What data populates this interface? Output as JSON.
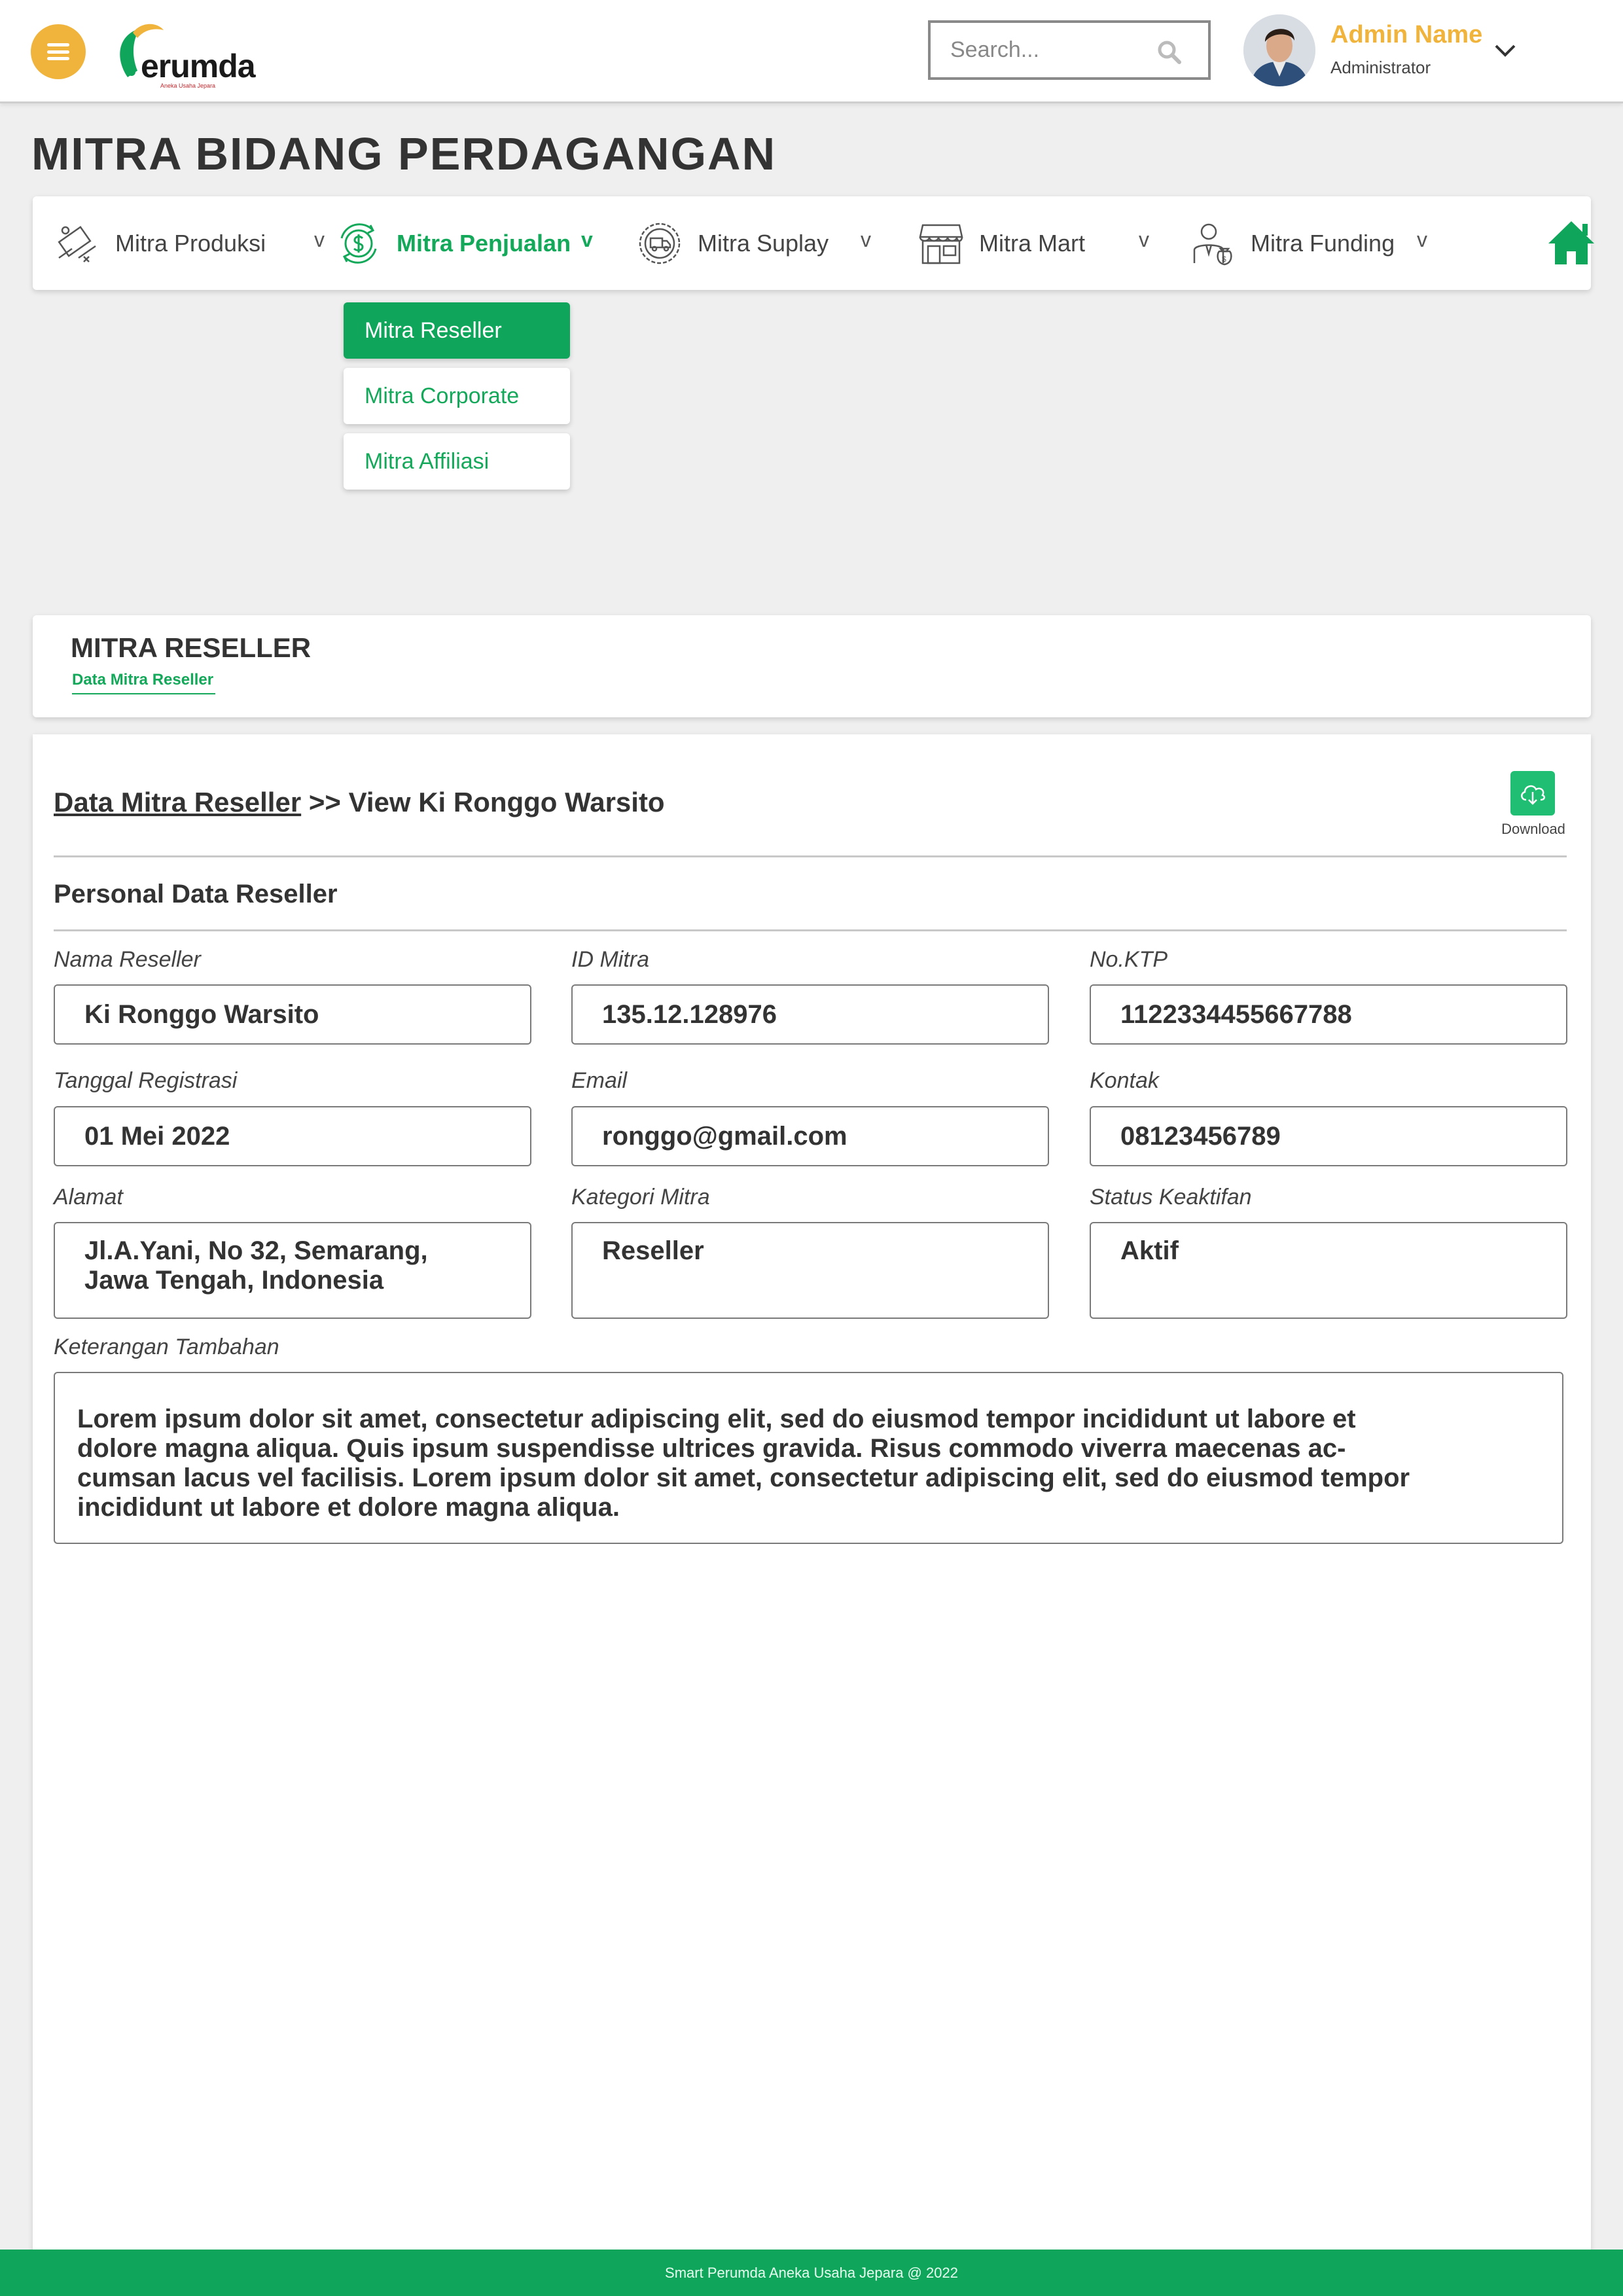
{
  "header": {
    "logo_text": "erumda",
    "logo_subtext": "Aneka Usaha Jepara",
    "search_placeholder": "Search...",
    "admin_name": "Admin Name",
    "admin_role": "Administrator"
  },
  "page_title": "MITRA BIDANG PERDAGANGAN",
  "nav": {
    "items": [
      {
        "label": "Mitra Produksi",
        "icon": "production-icon",
        "caret": "v"
      },
      {
        "label": "Mitra Penjualan",
        "icon": "sales-dollar-icon",
        "caret": "v",
        "active": true
      },
      {
        "label": "Mitra Suplay",
        "icon": "supply-truck-icon",
        "caret": "v"
      },
      {
        "label": "Mitra Mart",
        "icon": "store-icon",
        "caret": "v"
      },
      {
        "label": "Mitra Funding",
        "icon": "funding-person-icon",
        "caret": "v"
      }
    ],
    "dropdown": [
      {
        "label": "Mitra Reseller",
        "active": true
      },
      {
        "label": "Mitra Corporate"
      },
      {
        "label": "Mitra Affiliasi"
      }
    ]
  },
  "section": {
    "title": "MITRA RESELLER",
    "tab": "Data Mitra Reseller"
  },
  "detail": {
    "breadcrumb_link": "Data Mitra Reseller",
    "breadcrumb_rest": ">> View Ki Ronggo Warsito",
    "download_label": "Download",
    "subheading": "Personal Data Reseller",
    "fields": {
      "nama_reseller": {
        "label": "Nama Reseller",
        "value": "Ki Ronggo Warsito"
      },
      "id_mitra": {
        "label": "ID Mitra",
        "value": "135.12.128976"
      },
      "no_ktp": {
        "label": "No.KTP",
        "value": "1122334455667788"
      },
      "tanggal_registrasi": {
        "label": "Tanggal Registrasi",
        "value": "01 Mei 2022"
      },
      "email": {
        "label": "Email",
        "value": "ronggo@gmail.com"
      },
      "kontak": {
        "label": "Kontak",
        "value": "08123456789"
      },
      "alamat": {
        "label": "Alamat",
        "value_line1": "Jl.A.Yani, No 32, Semarang,",
        "value_line2": "Jawa Tengah, Indonesia"
      },
      "kategori_mitra": {
        "label": "Kategori Mitra",
        "value": "Reseller"
      },
      "status_keaktifan": {
        "label": "Status Keaktifan",
        "value": "Aktif"
      },
      "keterangan": {
        "label": "Keterangan Tambahan",
        "lines": [
          "Lorem ipsum dolor sit amet, consectetur adipiscing elit, sed do eiusmod tempor incididunt ut labore et",
          "dolore magna aliqua. Quis ipsum suspendisse ultrices gravida. Risus commodo viverra maecenas ac-",
          "cumsan lacus vel facilisis. Lorem ipsum dolor sit amet, consectetur adipiscing elit, sed do eiusmod tempor",
          "incididunt ut labore et dolore magna aliqua."
        ]
      }
    }
  },
  "footer": "Smart Perumda Aneka Usaha Jepara @ 2022",
  "colors": {
    "accent_green": "#0fa65c",
    "accent_orange": "#f0b43c"
  }
}
